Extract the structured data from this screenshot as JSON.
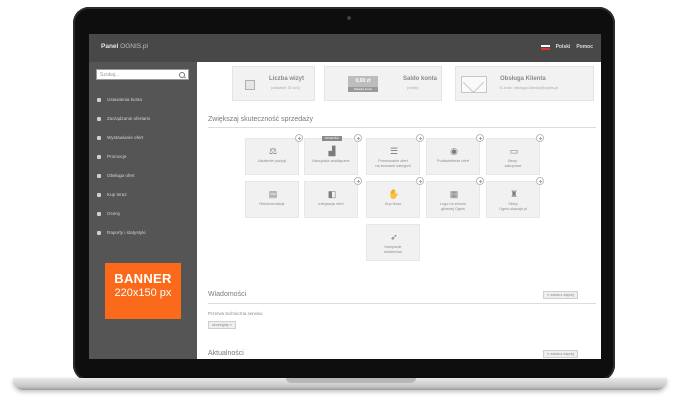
{
  "topbar": {
    "brand": "Panel",
    "brand_sub": "OGNIS.pl",
    "lang_label": "Polski",
    "help_label": "Pomoc"
  },
  "sidebar": {
    "search_placeholder": "Szukaj...",
    "items": [
      {
        "label": "Ustawienia konta",
        "icon": "home-icon"
      },
      {
        "label": "Zarządzanie ofertami",
        "icon": "wrench-icon"
      },
      {
        "label": "Wystawianie ofert",
        "icon": "cart-icon"
      },
      {
        "label": "Promocje",
        "icon": "megaphone-icon"
      },
      {
        "label": "Obsługa ofert",
        "icon": "tag-icon"
      },
      {
        "label": "Kup teraz",
        "icon": "cart-arrow-icon"
      },
      {
        "label": "Oceny",
        "icon": "chat-icon"
      },
      {
        "label": "Raporty i statystyki",
        "icon": "chart-icon"
      }
    ]
  },
  "banner": {
    "line1": "BANNER",
    "line2": "220x150 px"
  },
  "stats": {
    "listings_title": "Liczba wizyt",
    "listings_sub": "(ostatnie 30 dni)",
    "balance_badge": "0,00 zł",
    "balance_badge_strip": "Doładuj konto",
    "balance_title": "Saldo konta",
    "balance_sub": "(netto)",
    "support_title": "Obsługa Klienta",
    "support_sub": "E-mail: obsluga.klienta@ognis.pl"
  },
  "sales_section": {
    "title": "Zwiększaj skuteczność sprzedaży",
    "tiles": [
      {
        "label": "Ustalenie pozycji",
        "icon": "gavel-icon",
        "glyph": "⚖"
      },
      {
        "label": "Narzędzia analityczne",
        "icon": "chart-up-icon",
        "glyph": "▟",
        "badge": "NOWOŚĆ"
      },
      {
        "label": "Promowanie ofert\nna stronach kategorii",
        "icon": "list-icon",
        "glyph": "☰"
      },
      {
        "label": "Podświetlenie ofert",
        "icon": "eye-icon",
        "glyph": "◉"
      },
      {
        "label": "Bezp.\nzakupowe",
        "icon": "shield-icon",
        "glyph": "▭"
      },
      {
        "label": "Rekomendacje",
        "icon": "banner-icon",
        "glyph": "▤"
      },
      {
        "label": "Integracja ofert",
        "icon": "puzzle-icon",
        "glyph": "◧"
      },
      {
        "label": "Kup teraz",
        "icon": "hand-icon",
        "glyph": "✋"
      },
      {
        "label": "Logo na stronie\ngłównej Ognis",
        "icon": "grid-icon",
        "glyph": "▦"
      },
      {
        "label": "Sklep\nOgnis.ukazuje.pl",
        "icon": "bag-icon",
        "glyph": "♜"
      },
      {
        "label": "Kampanie\nreklamowe",
        "icon": "rocket-icon",
        "glyph": "➶"
      }
    ]
  },
  "messages": {
    "title": "Wiadomości",
    "show_all": "zobacz więcej",
    "item_text": "Przerwa techniczna serwisu",
    "details_button": "szczegóły »"
  },
  "news": {
    "title": "Aktualności",
    "show_all": "zobacz więcej"
  }
}
